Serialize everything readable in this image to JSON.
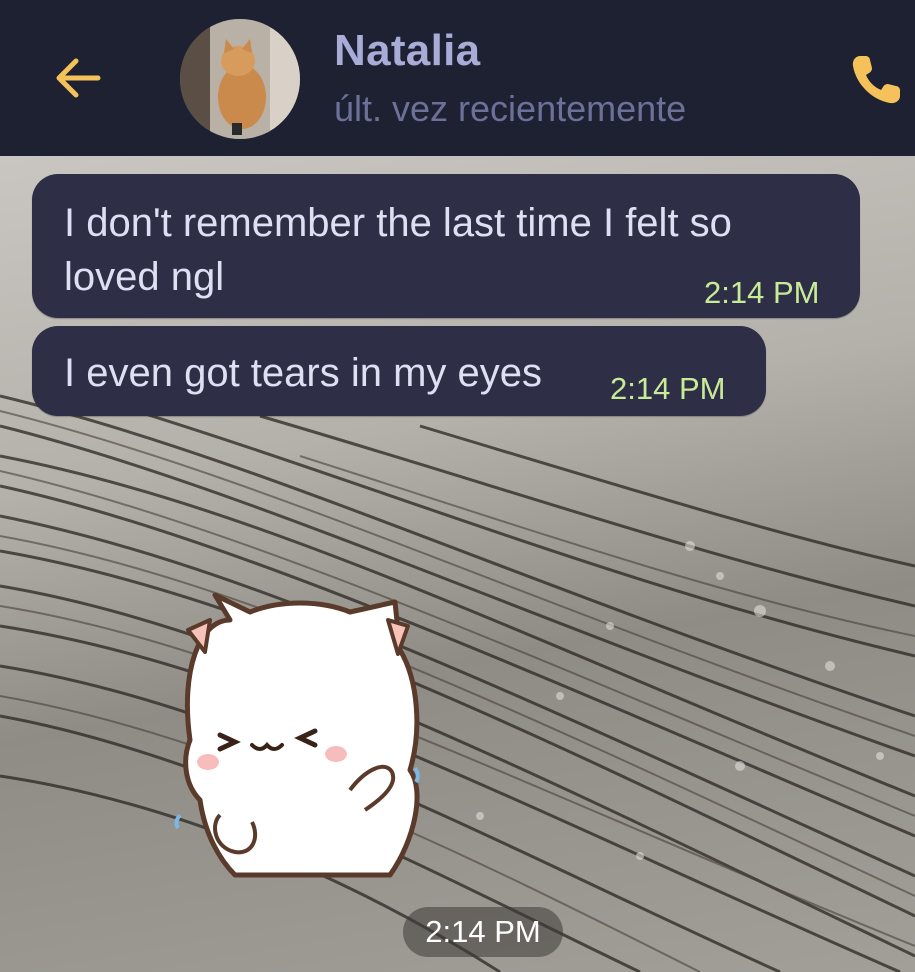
{
  "header": {
    "back_icon": "arrow-left-icon",
    "contact_name": "Natalia",
    "contact_status": "últ. vez recientemente",
    "call_icon": "phone-icon",
    "accent_color": "#f5c15a",
    "background_color": "#1e2131"
  },
  "messages": [
    {
      "lines": [
        "I don't remember the last time I felt so",
        "loved ngl"
      ],
      "time": "2:14 PM"
    },
    {
      "lines": [
        "I even got tears in my eyes"
      ],
      "time": "2:14 PM"
    }
  ],
  "sticker": {
    "icon": "white-cat-sticker",
    "time": "2:14 PM"
  },
  "colors": {
    "bubble": "#2e2e47",
    "bubble_text": "#dde0f2",
    "time_text": "#c8eb98"
  }
}
